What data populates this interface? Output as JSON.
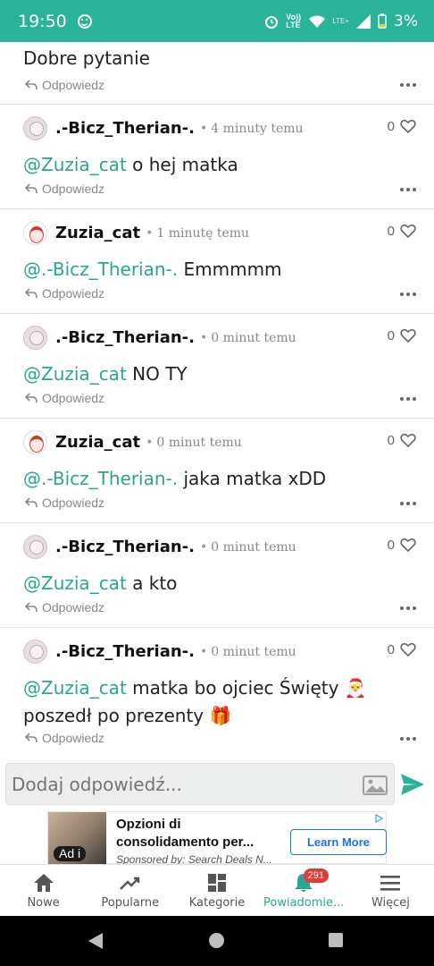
{
  "status_bar": {
    "time": "19:50",
    "network_label": "Vo)) LTE",
    "signal_label": "LTE+",
    "battery": "3%"
  },
  "first_comment": {
    "text": "Dobre pytanie",
    "reply_label": "Odpowiedz"
  },
  "comments": [
    {
      "author": ".-Bicz_Therian-.",
      "avatar": "therian-avatar",
      "time": "4 minuty temu",
      "likes": "0",
      "mention": "@Zuzia_cat",
      "text": " o hej matka",
      "reply_label": "Odpowiedz"
    },
    {
      "author": "Zuzia_cat",
      "avatar": "santa-avatar",
      "time": "1 minutę temu",
      "likes": "0",
      "mention": "@.-Bicz_Therian-.",
      "text": " Emmmmm",
      "reply_label": "Odpowiedz"
    },
    {
      "author": ".-Bicz_Therian-.",
      "avatar": "therian-avatar",
      "time": "0 minut temu",
      "likes": "0",
      "mention": "@Zuzia_cat",
      "text": " NO TY",
      "reply_label": "Odpowiedz"
    },
    {
      "author": "Zuzia_cat",
      "avatar": "santa-avatar",
      "time": "0 minut temu",
      "likes": "0",
      "mention": "@.-Bicz_Therian-.",
      "text": " jaka matka xDD",
      "reply_label": "Odpowiedz"
    },
    {
      "author": ".-Bicz_Therian-.",
      "avatar": "therian-avatar",
      "time": "0 minut temu",
      "likes": "0",
      "mention": "@Zuzia_cat",
      "text": " a kto",
      "reply_label": "Odpowiedz"
    },
    {
      "author": ".-Bicz_Therian-.",
      "avatar": "therian-avatar",
      "time": "0 minut temu",
      "likes": "0",
      "mention": "@Zuzia_cat",
      "text": " matka bo ojciec Święty 🎅 poszedł po prezenty 🎁",
      "reply_label": "Odpowiedz"
    }
  ],
  "reply_bar": {
    "placeholder": "Dodaj odpowiedź..."
  },
  "ad": {
    "badge": "Ad i",
    "title": "Opzioni di consolidamento per...",
    "sponsor": "Sponsored by: Search Deals N...",
    "cta": "Learn More"
  },
  "tabs": [
    {
      "label": "Nowe",
      "icon": "home-icon"
    },
    {
      "label": "Popularne",
      "icon": "trending-icon"
    },
    {
      "label": "Kategorie",
      "icon": "grid-icon"
    },
    {
      "label": "Powiadomie...",
      "icon": "bell-icon",
      "badge": "291",
      "active": true
    },
    {
      "label": "Więcej",
      "icon": "menu-icon"
    }
  ],
  "colors": {
    "accent": "#2bb39a",
    "mention": "#2aa58f",
    "badge": "#e53935"
  }
}
